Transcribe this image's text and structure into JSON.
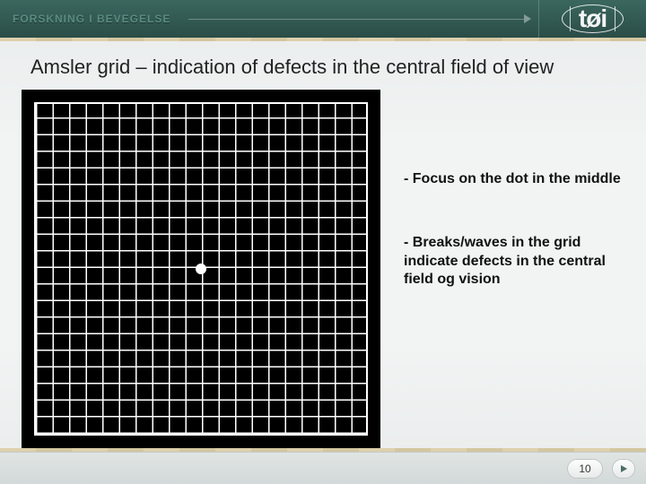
{
  "header": {
    "tagline": "FORSKNING I BEVEGELSE",
    "logo": "tøi"
  },
  "title": "Amsler grid – indication of defects in the central field of view",
  "bullets": [
    "- Focus on the dot in the middle",
    "- Breaks/waves in the grid indicate defects in the central field og vision"
  ],
  "grid": {
    "cells_per_side": 20,
    "has_center_dot": true
  },
  "footer": {
    "page_number": "10"
  },
  "colors": {
    "header_bg": "#2f564f",
    "grid_bg": "#000000",
    "grid_line": "#ffffff"
  }
}
